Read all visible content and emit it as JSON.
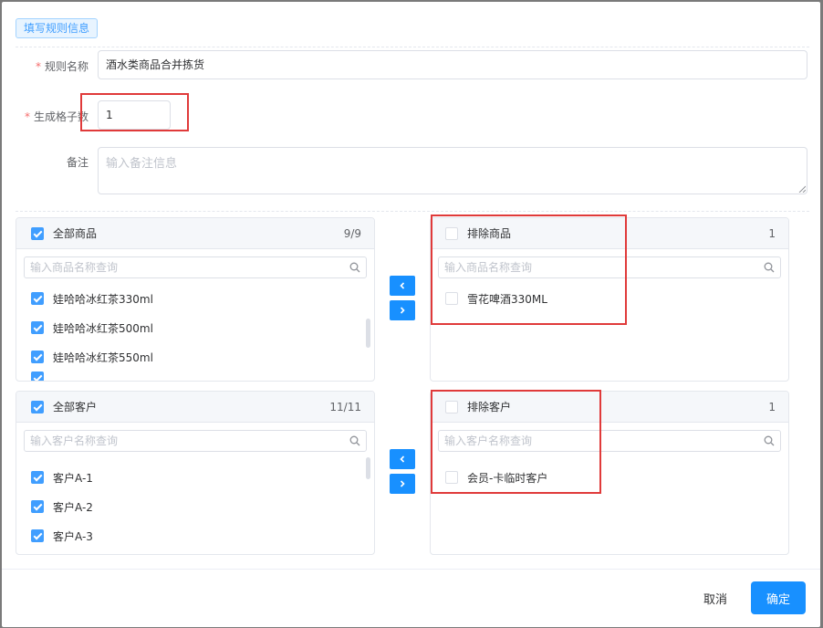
{
  "section_tag": "填写规则信息",
  "form": {
    "rule_name": {
      "label": "规则名称",
      "value": "酒水类商品合并拣货"
    },
    "grid_count": {
      "label": "生成格子数",
      "value": "1"
    },
    "remark": {
      "label": "备注",
      "placeholder": "输入备注信息"
    }
  },
  "product_transfer": {
    "left": {
      "title": "全部商品",
      "count": "9/9",
      "checked": true,
      "search_placeholder": "输入商品名称查询",
      "items": [
        {
          "label": "娃哈哈冰红茶330ml",
          "checked": true
        },
        {
          "label": "娃哈哈冰红茶500ml",
          "checked": true
        },
        {
          "label": "娃哈哈冰红茶550ml",
          "checked": true
        }
      ]
    },
    "right": {
      "title": "排除商品",
      "count": "1",
      "checked": false,
      "search_placeholder": "输入商品名称查询",
      "items": [
        {
          "label": "雪花啤酒330ML",
          "checked": false
        }
      ]
    }
  },
  "customer_transfer": {
    "left": {
      "title": "全部客户",
      "count": "11/11",
      "checked": true,
      "search_placeholder": "输入客户名称查询",
      "items": [
        {
          "label": "客户A-1",
          "checked": true
        },
        {
          "label": "客户A-2",
          "checked": true
        },
        {
          "label": "客户A-3",
          "checked": true
        }
      ]
    },
    "right": {
      "title": "排除客户",
      "count": "1",
      "checked": false,
      "search_placeholder": "输入客户名称查询",
      "items": [
        {
          "label": "会员-卡临时客户",
          "checked": false
        }
      ]
    }
  },
  "footer": {
    "cancel": "取消",
    "confirm": "确定"
  },
  "colors": {
    "primary": "#1890ff",
    "highlight": "#e03a3a",
    "required": "#f56c6c"
  }
}
